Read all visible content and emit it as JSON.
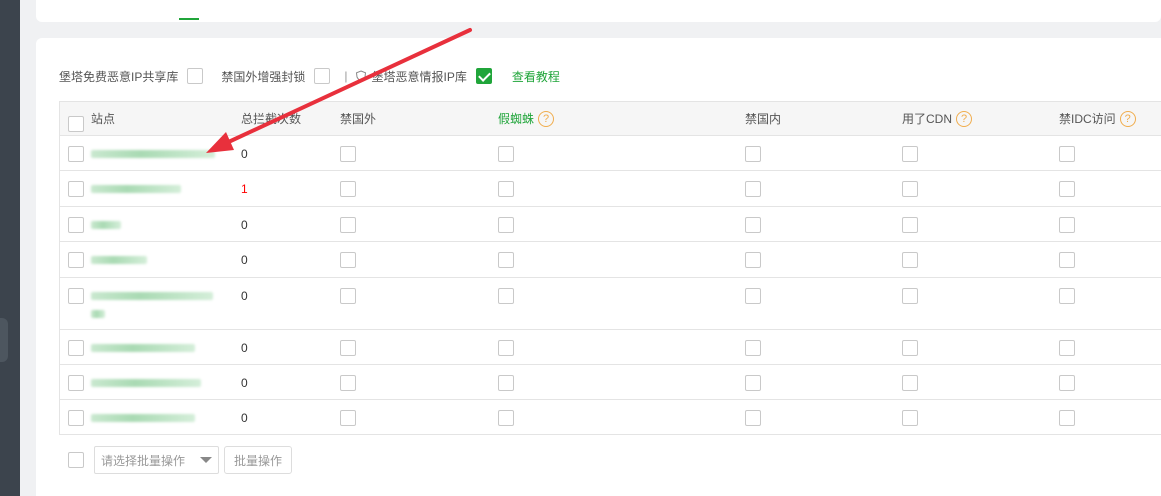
{
  "toolbar": {
    "option1_label": "堡塔免费恶意IP共享库",
    "option1_checked": false,
    "option2_label": "禁国外增强封锁",
    "option2_checked": false,
    "separator": "|",
    "option3_label": "堡塔恶意情报IP库",
    "option3_checked": true,
    "tutorial_link": "查看教程"
  },
  "table": {
    "headers": {
      "site": "站点",
      "total_blocks": "总拦截次数",
      "block_foreign": "禁国外",
      "fake_spider": "假蜘蛛",
      "block_domestic": "禁国内",
      "used_cdn": "用了CDN",
      "block_idc": "禁IDC访问"
    },
    "help_icon": "?",
    "rows": [
      {
        "count": "0",
        "highlight": false
      },
      {
        "count": "1",
        "highlight": true
      },
      {
        "count": "0",
        "highlight": false
      },
      {
        "count": "0",
        "highlight": false
      },
      {
        "count": "0",
        "highlight": false
      },
      {
        "count": "0",
        "highlight": false
      },
      {
        "count": "0",
        "highlight": false
      },
      {
        "count": "0",
        "highlight": false
      }
    ]
  },
  "bottom": {
    "batch_select_placeholder": "请选择批量操作",
    "batch_button": "批量操作"
  },
  "colors": {
    "accent": "#20a53a",
    "help": "#f0ad4e",
    "arrow": "#e8303c",
    "alert_count": "#ff0000"
  }
}
